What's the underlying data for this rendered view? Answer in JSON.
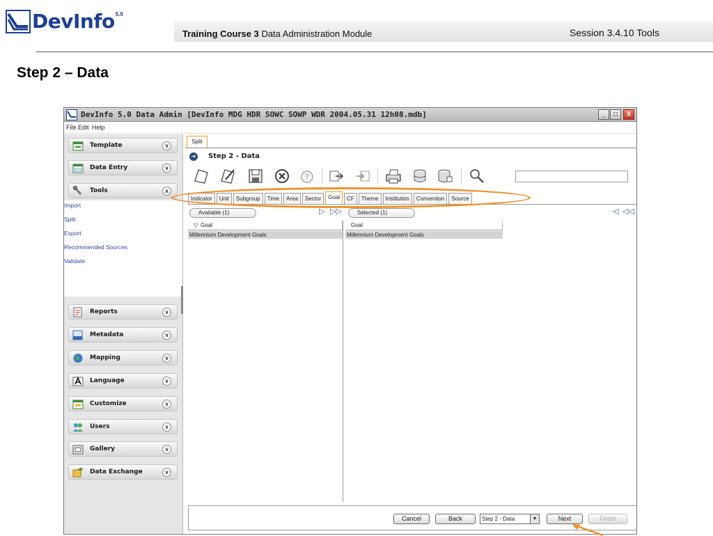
{
  "slide": {
    "logo_text": "DevInfo",
    "logo_version": "5.0",
    "course_bold": "Training Course 3",
    "course_rest": "Data Administration Module",
    "session": "Session 3.4.10 Tools",
    "title": "Step 2 – Data"
  },
  "window": {
    "title": "DevInfo 5.0 Data Admin [DevInfo MDG HDR SOWC SOWP WDR 2004.05.31 12h08.mdb]",
    "controls": {
      "minimize": "_",
      "maximize": "□",
      "close": "X"
    },
    "menu": [
      "File",
      "Edit",
      "Help"
    ]
  },
  "sidebar": {
    "groups": [
      {
        "label": "Template",
        "icon": "template-icon",
        "expanded": false
      },
      {
        "label": "Data Entry",
        "icon": "data-entry-icon",
        "expanded": false
      },
      {
        "label": "Tools",
        "icon": "wrench-icon",
        "expanded": true
      },
      {
        "label": "Reports",
        "icon": "reports-icon",
        "expanded": false
      },
      {
        "label": "Metadata",
        "icon": "metadata-icon",
        "expanded": false
      },
      {
        "label": "Mapping",
        "icon": "globe-icon",
        "expanded": false
      },
      {
        "label": "Language",
        "icon": "language-icon",
        "expanded": false
      },
      {
        "label": "Customize",
        "icon": "customize-icon",
        "expanded": false
      },
      {
        "label": "Users",
        "icon": "users-icon",
        "expanded": false
      },
      {
        "label": "Gallery",
        "icon": "gallery-icon",
        "expanded": false
      },
      {
        "label": "Data Exchange",
        "icon": "data-exchange-icon",
        "expanded": false
      }
    ],
    "tools_items": [
      "Import",
      "Split",
      "Export",
      "Recommended Sources",
      "Validate"
    ]
  },
  "main": {
    "panel_tab": "Split",
    "step_title": "Step 2 - Data",
    "toolbar_icons": [
      "new-icon",
      "edit-icon",
      "save-icon",
      "delete-icon",
      "help-icon",
      "import-icon",
      "export-icon",
      "print-icon",
      "database-icon",
      "database-save-icon",
      "search-icon"
    ],
    "data_tabs": [
      "Indicator",
      "Unit",
      "Subgroup",
      "Time",
      "Area",
      "Sector",
      "Goal",
      "CF",
      "Theme",
      "Institution",
      "Convention",
      "Source"
    ],
    "active_tab": "Goal",
    "available_label": "Available (1)",
    "selected_label": "Selected (1)",
    "available_column": "Goal",
    "selected_column": "Goal",
    "available_items": [
      "Millennium Development Goals"
    ],
    "selected_items": [
      "Millennium Development Goals"
    ]
  },
  "footer": {
    "cancel": "Cancel",
    "back": "Back",
    "step_select": "Step 2 - Data",
    "next": "Next",
    "finish": "Finish"
  },
  "colors": {
    "brand": "#1c3f94",
    "highlight": "#f0902a",
    "tab_active_border": "#f0a020"
  }
}
